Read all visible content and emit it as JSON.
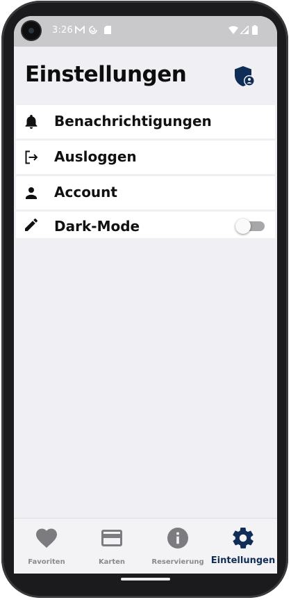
{
  "status_bar": {
    "time": "3:26"
  },
  "header": {
    "title": "Einstellungen"
  },
  "settings": {
    "items": [
      {
        "label": "Benachrichtigungen",
        "icon": "bell-icon"
      },
      {
        "label": "Ausloggen",
        "icon": "logout-icon"
      },
      {
        "label": "Account",
        "icon": "person-icon"
      },
      {
        "label": "Dark-Mode",
        "icon": "pencil-icon",
        "toggle_on": false
      }
    ]
  },
  "bottom_nav": {
    "items": [
      {
        "label": "Favoriten",
        "icon": "heart-icon",
        "active": false
      },
      {
        "label": "Karten",
        "icon": "card-icon",
        "active": false
      },
      {
        "label": "Reservierung",
        "icon": "info-icon",
        "active": false
      },
      {
        "label": "Eintellungen",
        "icon": "gear-icon",
        "active": true
      }
    ]
  },
  "colors": {
    "accent": "#0f2d57",
    "background": "#f0f0f4",
    "inactive": "#8a8a8d"
  }
}
